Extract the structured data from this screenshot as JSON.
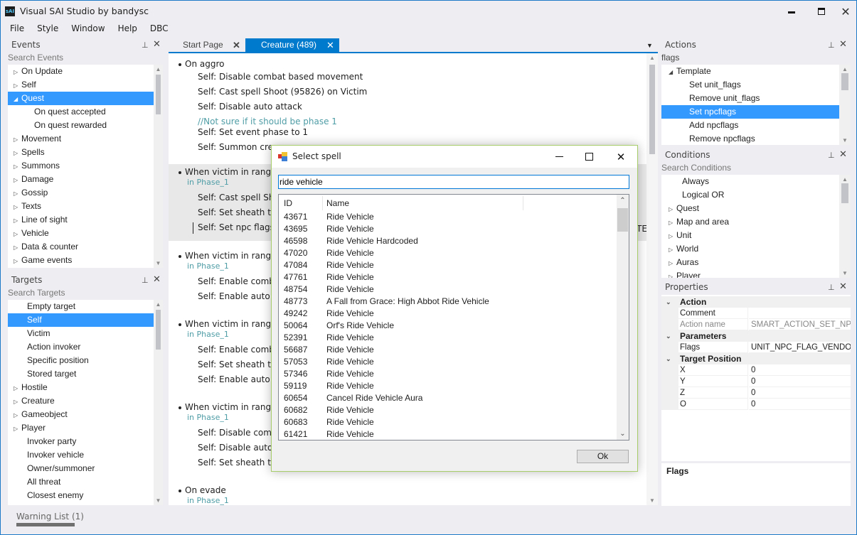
{
  "app": {
    "title": "Visual SAI Studio by bandysc",
    "icon_text": "sAI"
  },
  "menu": [
    "File",
    "Style",
    "Window",
    "Help",
    "DBC"
  ],
  "events_panel": {
    "title": "Events",
    "search_placeholder": "Search Events",
    "items": [
      {
        "label": "On Update",
        "expander": "collapsed",
        "level": 0
      },
      {
        "label": "Self",
        "expander": "collapsed",
        "level": 0
      },
      {
        "label": "Quest",
        "expander": "expanded",
        "level": 0,
        "selected": true
      },
      {
        "label": "On quest accepted",
        "expander": "none",
        "level": 1
      },
      {
        "label": "On quest rewarded",
        "expander": "none",
        "level": 1
      },
      {
        "label": "Movement",
        "expander": "collapsed",
        "level": 0
      },
      {
        "label": "Spells",
        "expander": "collapsed",
        "level": 0
      },
      {
        "label": "Summons",
        "expander": "collapsed",
        "level": 0
      },
      {
        "label": "Damage",
        "expander": "collapsed",
        "level": 0
      },
      {
        "label": "Gossip",
        "expander": "collapsed",
        "level": 0
      },
      {
        "label": "Texts",
        "expander": "collapsed",
        "level": 0
      },
      {
        "label": "Line of sight",
        "expander": "collapsed",
        "level": 0
      },
      {
        "label": "Vehicle",
        "expander": "collapsed",
        "level": 0
      },
      {
        "label": "Data & counter",
        "expander": "collapsed",
        "level": 0
      },
      {
        "label": "Game events",
        "expander": "collapsed",
        "level": 0
      }
    ]
  },
  "targets_panel": {
    "title": "Targets",
    "search_placeholder": "Search Targets",
    "items": [
      {
        "label": "Empty target",
        "expander": "none"
      },
      {
        "label": "Self",
        "expander": "none",
        "selected": true
      },
      {
        "label": "Victim",
        "expander": "none"
      },
      {
        "label": "Action invoker",
        "expander": "none"
      },
      {
        "label": "Specific position",
        "expander": "none"
      },
      {
        "label": "Stored target",
        "expander": "none"
      },
      {
        "label": "Hostile",
        "expander": "collapsed"
      },
      {
        "label": "Creature",
        "expander": "collapsed"
      },
      {
        "label": "Gameobject",
        "expander": "collapsed"
      },
      {
        "label": "Player",
        "expander": "collapsed"
      },
      {
        "label": "Invoker party",
        "expander": "none"
      },
      {
        "label": "Invoker vehicle",
        "expander": "none"
      },
      {
        "label": "Owner/summoner",
        "expander": "none"
      },
      {
        "label": "All threat",
        "expander": "none"
      },
      {
        "label": "Closest enemy",
        "expander": "none"
      }
    ]
  },
  "tabs": [
    {
      "label": "Start Page",
      "active": false
    },
    {
      "label": "Creature (489)",
      "active": true
    }
  ],
  "editor": {
    "events": [
      {
        "title": "On aggro",
        "phase": "",
        "highlight": false,
        "lines": [
          {
            "type": "action",
            "text": "Self: Disable combat based movement"
          },
          {
            "type": "action",
            "text": "Self: Cast spell Shoot (95826) on Victim"
          },
          {
            "type": "action",
            "text": "Self: Disable auto attack"
          },
          {
            "type": "comment",
            "text": "//Not sure if it should be phase 1"
          },
          {
            "type": "action",
            "text": "Self: Set event phase to 1"
          },
          {
            "type": "action",
            "text": "Self: Summon crea"
          }
        ]
      },
      {
        "title": "When victim in range",
        "phase": "in Phase_1",
        "highlight": true,
        "lines": [
          {
            "type": "action",
            "text": "Self: Cast spell Sho"
          },
          {
            "type": "action",
            "text": "Self: Set sheath to"
          },
          {
            "type": "action",
            "text": "Self: Set npc flags",
            "caret": true
          }
        ],
        "overflow_text": "TE"
      },
      {
        "title": "When victim in range",
        "phase": "in Phase_1",
        "highlight": false,
        "lines": [
          {
            "type": "action",
            "text": "Self: Enable comba"
          },
          {
            "type": "action",
            "text": "Self: Enable auto a"
          }
        ]
      },
      {
        "title": "When victim in range",
        "phase": "in Phase_1",
        "highlight": false,
        "lines": [
          {
            "type": "action",
            "text": "Self: Enable comba"
          },
          {
            "type": "action",
            "text": "Self: Set sheath to"
          },
          {
            "type": "action",
            "text": "Self: Enable auto a"
          }
        ]
      },
      {
        "title": "When victim in range",
        "phase": "in Phase_1",
        "highlight": false,
        "lines": [
          {
            "type": "action",
            "text": "Self: Disable comb"
          },
          {
            "type": "action",
            "text": "Self: Disable auto a"
          },
          {
            "type": "action",
            "text": "Self: Set sheath to"
          }
        ]
      },
      {
        "title": "On evade",
        "phase": "in Phase_1",
        "highlight": false,
        "lines": []
      }
    ]
  },
  "actions_panel": {
    "title": "Actions",
    "search_value": "flags",
    "items": [
      {
        "label": "Template",
        "expander": "expanded",
        "level": 0
      },
      {
        "label": "Set unit_flags",
        "expander": "none",
        "level": 1
      },
      {
        "label": "Remove unit_flags",
        "expander": "none",
        "level": 1
      },
      {
        "label": "Set npcflags",
        "expander": "none",
        "level": 1,
        "selected": true
      },
      {
        "label": "Add npcflags",
        "expander": "none",
        "level": 1
      },
      {
        "label": "Remove npcflags",
        "expander": "none",
        "level": 1
      }
    ]
  },
  "conditions_panel": {
    "title": "Conditions",
    "search_placeholder": "Search Conditions",
    "items": [
      {
        "label": "Always",
        "expander": "none"
      },
      {
        "label": "Logical OR",
        "expander": "none"
      },
      {
        "label": "Quest",
        "expander": "collapsed"
      },
      {
        "label": "Map and area",
        "expander": "collapsed"
      },
      {
        "label": "Unit",
        "expander": "collapsed"
      },
      {
        "label": "World",
        "expander": "collapsed"
      },
      {
        "label": "Auras",
        "expander": "collapsed"
      },
      {
        "label": "Player",
        "expander": "collapsed"
      }
    ]
  },
  "properties_panel": {
    "title": "Properties",
    "categories": [
      {
        "name": "Action",
        "rows": [
          {
            "name": "Comment",
            "value": "",
            "readonly": false
          },
          {
            "name": "Action name",
            "value": "SMART_ACTION_SET_NPC",
            "readonly": true
          }
        ]
      },
      {
        "name": "Parameters",
        "rows": [
          {
            "name": "Flags",
            "value": "UNIT_NPC_FLAG_VENDOR",
            "readonly": false
          }
        ]
      },
      {
        "name": "Target Position",
        "rows": [
          {
            "name": "X",
            "value": "0",
            "readonly": false
          },
          {
            "name": "Y",
            "value": "0",
            "readonly": false
          },
          {
            "name": "Z",
            "value": "0",
            "readonly": false
          },
          {
            "name": "O",
            "value": "0",
            "readonly": false
          }
        ]
      }
    ],
    "description_title": "Flags"
  },
  "warning_list": {
    "label": "Warning List (1)"
  },
  "dialog": {
    "title": "Select spell",
    "search_value": "ride vehicle",
    "columns": [
      "ID",
      "Name"
    ],
    "rows": [
      {
        "id": "43671",
        "name": "Ride Vehicle"
      },
      {
        "id": "43695",
        "name": "Ride Vehicle"
      },
      {
        "id": "46598",
        "name": "Ride Vehicle Hardcoded"
      },
      {
        "id": "47020",
        "name": "Ride Vehicle"
      },
      {
        "id": "47084",
        "name": "Ride Vehicle"
      },
      {
        "id": "47761",
        "name": "Ride Vehicle"
      },
      {
        "id": "48754",
        "name": "Ride Vehicle"
      },
      {
        "id": "48773",
        "name": "A Fall from Grace: High Abbot Ride Vehicle"
      },
      {
        "id": "49242",
        "name": "Ride Vehicle"
      },
      {
        "id": "50064",
        "name": "Orf's Ride Vehicle"
      },
      {
        "id": "52391",
        "name": "Ride Vehicle"
      },
      {
        "id": "56687",
        "name": "Ride Vehicle"
      },
      {
        "id": "57053",
        "name": "Ride Vehicle"
      },
      {
        "id": "57346",
        "name": "Ride Vehicle"
      },
      {
        "id": "59119",
        "name": "Ride Vehicle"
      },
      {
        "id": "60654",
        "name": "Cancel Ride Vehicle Aura"
      },
      {
        "id": "60682",
        "name": "Ride Vehicle"
      },
      {
        "id": "60683",
        "name": "Ride Vehicle"
      },
      {
        "id": "61421",
        "name": "Ride Vehicle"
      }
    ],
    "ok_label": "Ok"
  },
  "colors": {
    "accent": "#007acc",
    "selection": "#3399ff",
    "phase_text": "#4f9da6"
  }
}
